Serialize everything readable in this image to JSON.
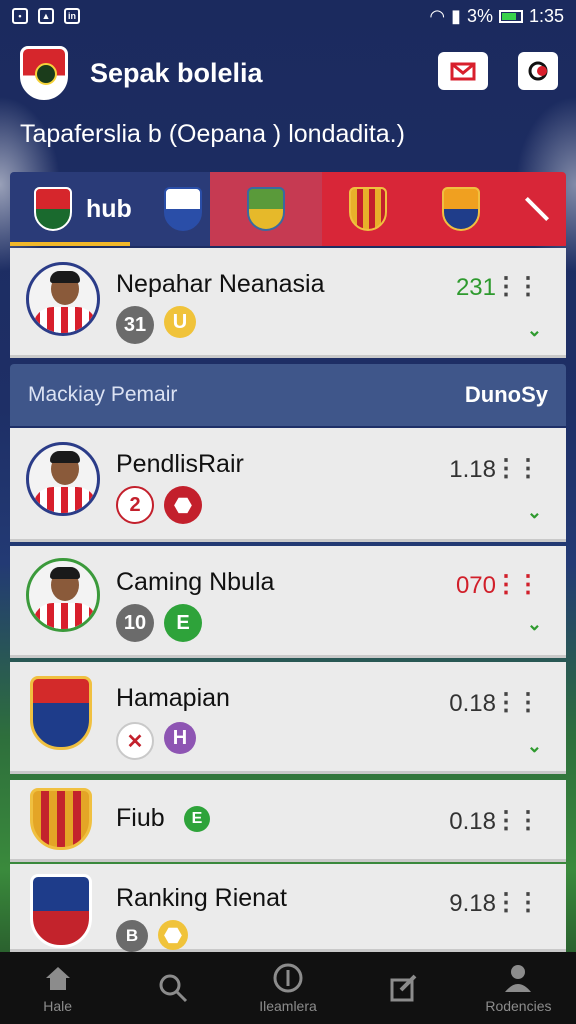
{
  "status_bar": {
    "time": "1:35",
    "battery": "3%"
  },
  "app": {
    "title": "Sepak bolelia",
    "subtitle": "Tapaferslia b (Oepana ) londadita.)"
  },
  "tabs": [
    {
      "label": "hub"
    }
  ],
  "featured_row": {
    "name": "Nepahar Neanasia",
    "score": "231",
    "badges": [
      "31",
      "U"
    ]
  },
  "section": {
    "left": "Mackiay Pemair",
    "right": "DunoSy"
  },
  "rows": [
    {
      "name": "PendlisRair",
      "score": "1.18",
      "badges": [
        "2",
        ""
      ]
    },
    {
      "name": "Caming Nbula",
      "score": "070",
      "badges": [
        "10",
        "E"
      ]
    },
    {
      "name": "Hamapian",
      "score": "0.18",
      "badges": [
        "",
        "H"
      ]
    },
    {
      "name": "Fiub",
      "score": "0.18",
      "badges": [
        "E"
      ]
    },
    {
      "name": "Ranking Rienat",
      "score": "9.18",
      "badges": [
        "B",
        ""
      ]
    }
  ],
  "bottom_nav": [
    {
      "label": "Hale",
      "icon": "home-icon"
    },
    {
      "label": "",
      "icon": "search-icon"
    },
    {
      "label": "Ileamlera",
      "icon": "ball-icon"
    },
    {
      "label": "",
      "icon": "edit-icon"
    },
    {
      "label": "Rodencies",
      "icon": "profile-icon"
    }
  ]
}
